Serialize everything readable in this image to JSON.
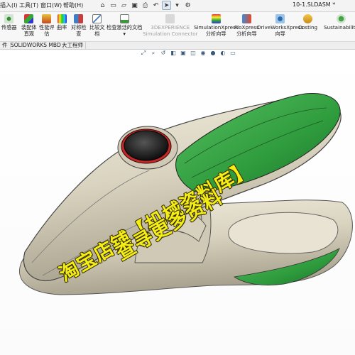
{
  "menu": {
    "items": [
      "插入(I)",
      "工具(T)",
      "窗口(W)",
      "帮助(H)"
    ],
    "file_title": "10-1.SLDASM *"
  },
  "ribbon": {
    "buttons": [
      {
        "label_1": "传感器",
        "label_2": "",
        "icon": "sensor-icon",
        "enabled": true
      },
      {
        "label_1": "装配体",
        "label_2": "直观",
        "icon": "assembly-visualization-icon",
        "enabled": true
      },
      {
        "label_1": "性能评",
        "label_2": "估",
        "icon": "performance-evaluation-icon",
        "enabled": true
      },
      {
        "label_1": "曲率",
        "label_2": "",
        "icon": "curvature-icon",
        "enabled": true
      },
      {
        "label_1": "对称检",
        "label_2": "查",
        "icon": "symmetry-check-icon",
        "enabled": true
      },
      {
        "label_1": "比较文",
        "label_2": "档",
        "icon": "compare-documents-icon",
        "enabled": true
      },
      {
        "label_1": "检查激活的文档",
        "label_2": "",
        "icon": "check-active-document-icon",
        "enabled": true
      },
      {
        "label_1": "3DEXPERIENCE",
        "label_2": "Simulation Connector",
        "icon": "simulation-connector-icon",
        "enabled": false
      },
      {
        "label_1": "SimulationXpress",
        "label_2": "分析向导",
        "icon": "simulationxpress-icon",
        "enabled": true
      },
      {
        "label_1": "FloXpress",
        "label_2": "分析向导",
        "icon": "floxpress-icon",
        "enabled": true
      },
      {
        "label_1": "DriveWorksXpress",
        "label_2": "向导",
        "icon": "driveworksxpress-icon",
        "enabled": true
      },
      {
        "label_1": "Costing",
        "label_2": "",
        "icon": "costing-icon",
        "enabled": true
      },
      {
        "label_1": "Sustainability",
        "label_2": "",
        "icon": "sustainability-icon",
        "enabled": true
      }
    ]
  },
  "tabs": {
    "items": [
      "件",
      "SOLIDWORKS MBD",
      "大工程师"
    ]
  },
  "watermark": {
    "line1": "淘宝店铺【机械资料库】",
    "line2": "查寻更多资料"
  },
  "colors": {
    "model_body": "#d9d3c0",
    "model_accent": "#2e9b3d",
    "button_ring": "#c0282a",
    "watermark": "#f5ee16"
  }
}
